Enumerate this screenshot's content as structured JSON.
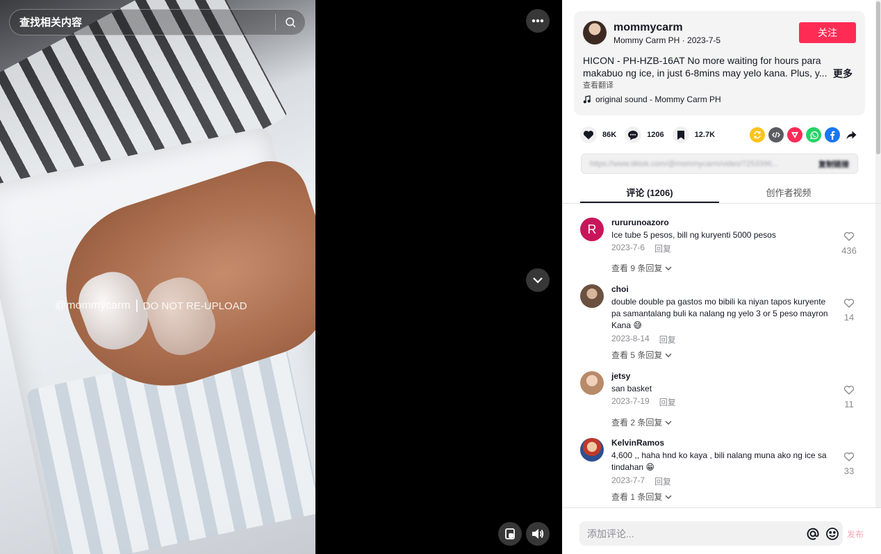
{
  "search": {
    "placeholder": "查找相关内容"
  },
  "video": {
    "watermark_user": "@mommycarm",
    "watermark_note": "DO NOT RE-UPLOAD"
  },
  "author": {
    "username": "mommycarm",
    "display_name": "Mommy Carm PH",
    "date": "2023-7-5",
    "follow_label": "关注"
  },
  "description": {
    "text": "HICON - PH-HZB-16AT No more waiting for hours para makabuo ng ice, in just 6-8mins may yelo kana. Plus, y...",
    "more_label": "更多",
    "translate_label": "查看翻译"
  },
  "music": {
    "title": "original sound - Mommy Carm PH"
  },
  "stats": {
    "likes": "86K",
    "comments": "1206",
    "saves": "12.7K"
  },
  "share_icons": [
    {
      "name": "repost-icon",
      "color": "#fcc319"
    },
    {
      "name": "embed-icon",
      "color": "#5b5b62"
    },
    {
      "name": "send-icon",
      "color": "#fe2c55"
    },
    {
      "name": "whatsapp-icon",
      "color": "#25d366"
    },
    {
      "name": "facebook-icon",
      "color": "#1877f2"
    },
    {
      "name": "share-arrow-icon",
      "color": "#161823"
    }
  ],
  "link_bar": {
    "url": "https://www.tiktok.com/@mommycarm/video/7253396...",
    "copy_label": "复制链接"
  },
  "tabs": [
    {
      "label": "评论 (1206)",
      "active": true
    },
    {
      "label": "创作者视频",
      "active": false
    }
  ],
  "comments": [
    {
      "user": "rururunoazoro",
      "avatar_letter": "R",
      "avatar_color": "#c8155a",
      "text": "Ice tube 5 pesos, bill ng kuryenti 5000 pesos",
      "date": "2023-7-6",
      "reply_label": "回复",
      "replies_label": "查看 9 条回复",
      "likes": "436"
    },
    {
      "user": "choi",
      "avatar_letter": "",
      "avatar_color": "#8b6b4e",
      "text": "double double pa gastos mo bibili ka niyan tapos kuryente pa samantalang buli ka nalang ng yelo 3 or 5 peso mayron Kana 😅",
      "date": "2023-8-14",
      "reply_label": "回复",
      "replies_label": "查看 5 条回复",
      "likes": "14"
    },
    {
      "user": "jetsy",
      "avatar_letter": "",
      "avatar_color": "#c79a7c",
      "text": "san basket",
      "date": "2023-7-19",
      "reply_label": "回复",
      "replies_label": "查看 2 条回复",
      "likes": "11"
    },
    {
      "user": "KelvinRamos",
      "avatar_letter": "",
      "avatar_color": "#2d4f8f",
      "text": "4,600 ,, haha hnd ko kaya , bili nalang muna ako ng ice sa tindahan 😁",
      "date": "2023-7-7",
      "reply_label": "回复",
      "replies_label": "查看 1 条回复",
      "likes": "33"
    }
  ],
  "composer": {
    "placeholder": "添加评论...",
    "post_label": "发布"
  }
}
